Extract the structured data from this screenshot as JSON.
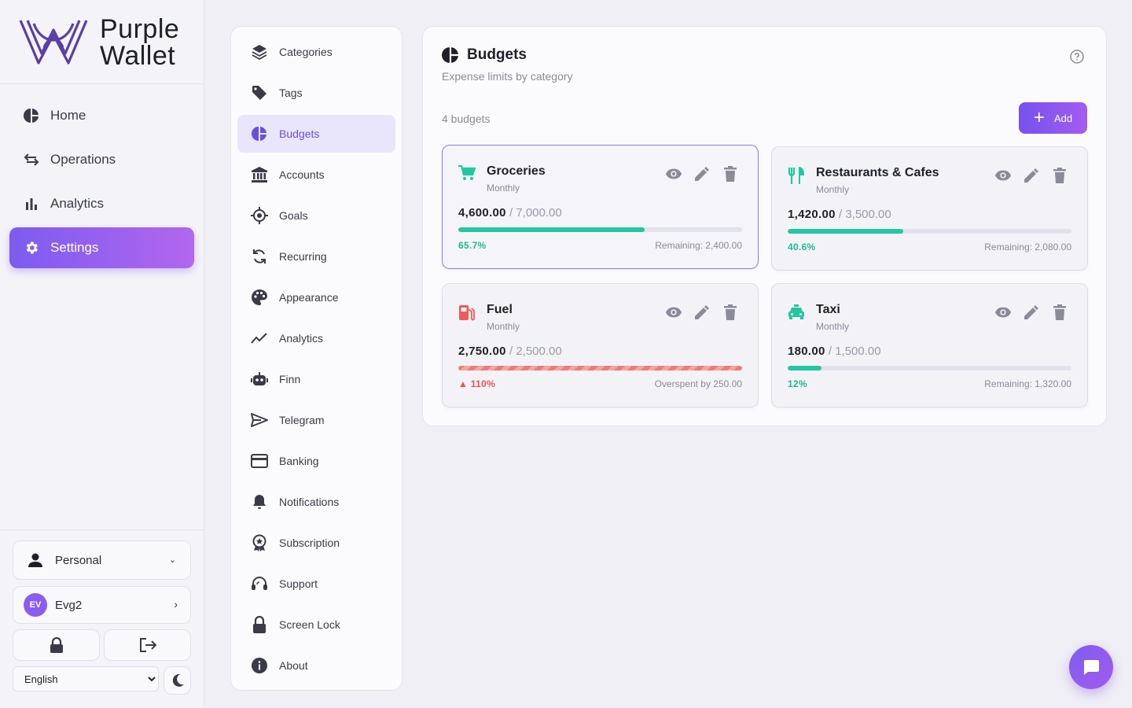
{
  "app": {
    "brand_line1": "Purple",
    "brand_line2": "Wallet"
  },
  "nav": [
    {
      "label": "Home",
      "icon": "pie-chart-icon"
    },
    {
      "label": "Operations",
      "icon": "swap-arrows-icon"
    },
    {
      "label": "Analytics",
      "icon": "bar-chart-icon"
    },
    {
      "label": "Settings",
      "icon": "gear-icon",
      "active": true
    }
  ],
  "sidebar_bottom": {
    "profile": "Personal",
    "user_initials": "EV",
    "user_name": "Evg2",
    "language": "English"
  },
  "settings_menu": [
    {
      "label": "Categories",
      "icon": "layers-icon"
    },
    {
      "label": "Tags",
      "icon": "tag-icon"
    },
    {
      "label": "Budgets",
      "icon": "pie-chart-icon",
      "active": true
    },
    {
      "label": "Accounts",
      "icon": "bank-icon"
    },
    {
      "label": "Goals",
      "icon": "target-icon"
    },
    {
      "label": "Recurring",
      "icon": "sync-icon"
    },
    {
      "label": "Appearance",
      "icon": "palette-icon"
    },
    {
      "label": "Analytics",
      "icon": "trend-line-icon"
    },
    {
      "label": "Finn",
      "icon": "robot-icon"
    },
    {
      "label": "Telegram",
      "icon": "send-icon"
    },
    {
      "label": "Banking",
      "icon": "credit-card-icon"
    },
    {
      "label": "Notifications",
      "icon": "bell-icon"
    },
    {
      "label": "Subscription",
      "icon": "award-icon"
    },
    {
      "label": "Support",
      "icon": "headset-icon"
    },
    {
      "label": "Screen Lock",
      "icon": "lock-icon"
    },
    {
      "label": "About",
      "icon": "info-icon"
    }
  ],
  "budgets": {
    "title": "Budgets",
    "subtitle": "Expense limits by category",
    "count_label": "4 budgets",
    "add_label": "Add",
    "items": [
      {
        "name": "Groceries",
        "period": "Monthly",
        "spent": "4,600.00",
        "limit": "7,000.00",
        "progress": 0.657,
        "percent_label": "65.7%",
        "status": "Remaining: 2,400.00",
        "over": false,
        "icon": "cart-icon",
        "icon_color": "#22c7a0"
      },
      {
        "name": "Restaurants & Cafes",
        "period": "Monthly",
        "spent": "1,420.00",
        "limit": "3,500.00",
        "progress": 0.406,
        "percent_label": "40.6%",
        "status": "Remaining: 2,080.00",
        "over": false,
        "icon": "fork-knife-icon",
        "icon_color": "#22c7a0"
      },
      {
        "name": "Fuel",
        "period": "Monthly",
        "spent": "2,750.00",
        "limit": "2,500.00",
        "progress": 1.0,
        "percent_label": "110%",
        "status": "Overspent by 250.00",
        "over": true,
        "icon": "gas-pump-icon",
        "icon_color": "#ef5a5a"
      },
      {
        "name": "Taxi",
        "period": "Monthly",
        "spent": "180.00",
        "limit": "1,500.00",
        "progress": 0.12,
        "percent_label": "12%",
        "status": "Remaining: 1,320.00",
        "over": false,
        "icon": "taxi-icon",
        "icon_color": "#22c7a0"
      }
    ]
  },
  "colors": {
    "accent": "#7c5cf0",
    "progress_ok": "#22c7a0",
    "progress_over": "#ef5050"
  }
}
